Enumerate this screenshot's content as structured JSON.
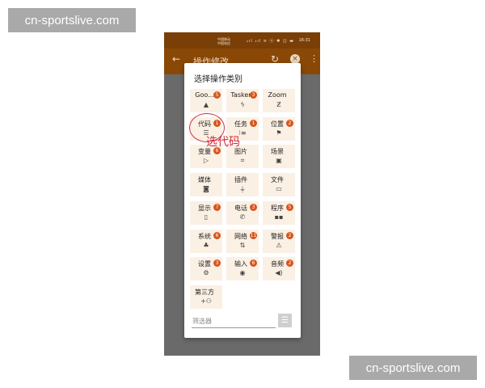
{
  "watermark": {
    "top": "cn-sportslive.com",
    "bottom": "cn-sportslive.com"
  },
  "status_bar": {
    "carrier1": "中国移动",
    "carrier2": "中国电信",
    "icons": "₄ıl ₄ıl ≋ ⓝ ✱ ◫ ▬",
    "time": "16:31"
  },
  "app_bar": {
    "title": "操作修改",
    "back_icon": "←",
    "refresh_icon": "↻",
    "close_icon": "×",
    "more_icon": "⋮"
  },
  "dialog": {
    "title": "选择操作类别",
    "categories": [
      {
        "label": "Goo...",
        "badge": "5",
        "icon": "google-drive-icon",
        "glyph": "▲"
      },
      {
        "label": "Tasker",
        "badge": "3",
        "icon": "bolt-icon",
        "glyph": "ϟ"
      },
      {
        "label": "Zoom",
        "badge": "",
        "icon": "zoom-icon",
        "glyph": "Ƶ"
      },
      {
        "label": "代码",
        "badge": "1",
        "icon": "code-list-icon",
        "glyph": "☰"
      },
      {
        "label": "任务",
        "badge": "1",
        "icon": "task-list-icon",
        "glyph": "⁝≡"
      },
      {
        "label": "位置",
        "badge": "2",
        "icon": "flag-icon",
        "glyph": "⚑"
      },
      {
        "label": "变量",
        "badge": "6",
        "icon": "label-icon",
        "glyph": "▷"
      },
      {
        "label": "图片",
        "badge": "",
        "icon": "crop-icon",
        "glyph": "⌗"
      },
      {
        "label": "场景",
        "badge": "",
        "icon": "image-icon",
        "glyph": "▣"
      },
      {
        "label": "媒体",
        "badge": "",
        "icon": "camera-icon",
        "glyph": "◙"
      },
      {
        "label": "插件",
        "badge": "",
        "icon": "plug-icon",
        "glyph": "⏚"
      },
      {
        "label": "文件",
        "badge": "",
        "icon": "folder-icon",
        "glyph": "▭"
      },
      {
        "label": "显示",
        "badge": "7",
        "icon": "phone-icon",
        "glyph": "▯"
      },
      {
        "label": "电话",
        "badge": "3",
        "icon": "call-icon",
        "glyph": "✆"
      },
      {
        "label": "程序",
        "badge": "5",
        "icon": "apps-icon",
        "glyph": "▪▪"
      },
      {
        "label": "系统",
        "badge": "6",
        "icon": "android-icon",
        "glyph": "♣"
      },
      {
        "label": "网络",
        "badge": "11",
        "icon": "network-transfer-icon",
        "glyph": "⇅"
      },
      {
        "label": "警报",
        "badge": "2",
        "icon": "warning-icon",
        "glyph": "⚠"
      },
      {
        "label": "设置",
        "badge": "3",
        "icon": "gear-icon",
        "glyph": "⚙"
      },
      {
        "label": "输入",
        "badge": "6",
        "icon": "mouse-icon",
        "glyph": "◉"
      },
      {
        "label": "音频",
        "badge": "2",
        "icon": "volume-icon",
        "glyph": "◀)"
      },
      {
        "label": "第三方",
        "badge": "",
        "icon": "group-add-icon",
        "glyph": "+⚇"
      }
    ],
    "filter_placeholder": "筛选器",
    "filter_value": "",
    "filter_button_icon": "☰"
  },
  "annotation": {
    "text": "选代码"
  },
  "colors": {
    "status_bar": "#7a3f06",
    "app_bar": "#8a4806",
    "tile_bg": "#fbf0e4",
    "badge": "#d8541c",
    "annotation": "#d2283c"
  }
}
